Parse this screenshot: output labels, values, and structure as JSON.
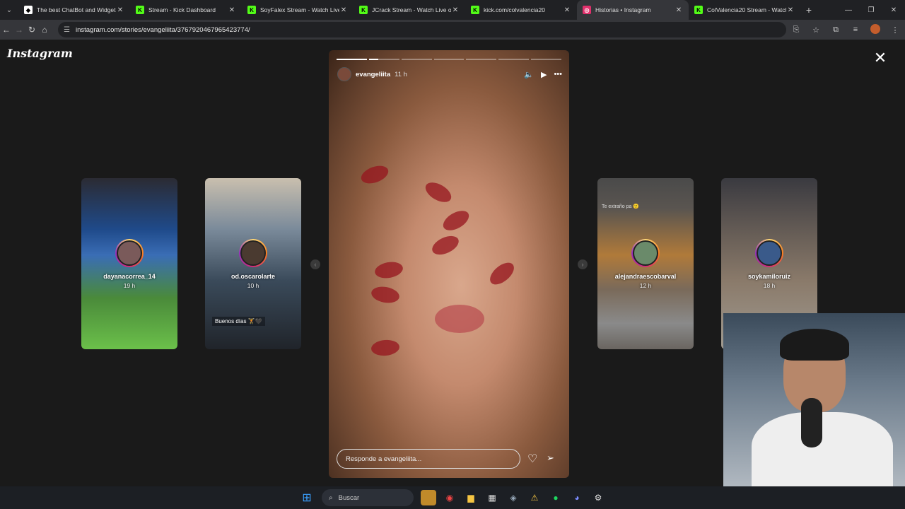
{
  "browser": {
    "tabs": [
      {
        "title": "The best ChatBot and Widgets",
        "favicon_color": "#ffffff",
        "favicon_glyph": "◆"
      },
      {
        "title": "Stream - Kick Dashboard",
        "favicon_color": "#53fc18",
        "favicon_glyph": "K"
      },
      {
        "title": "SoyFalex Stream - Watch Live o",
        "favicon_color": "#53fc18",
        "favicon_glyph": "K"
      },
      {
        "title": "JCrack Stream - Watch Live on",
        "favicon_color": "#53fc18",
        "favicon_glyph": "K"
      },
      {
        "title": "kick.com/colvalencia20",
        "favicon_color": "#53fc18",
        "favicon_glyph": "K"
      },
      {
        "title": "Historias • Instagram",
        "favicon_color": "#e1306c",
        "favicon_glyph": "◎"
      },
      {
        "title": "ColValencia20 Stream - Watch",
        "favicon_color": "#53fc18",
        "favicon_glyph": "K"
      }
    ],
    "url": "instagram.com/stories/evangeliita/3767920467965423774/"
  },
  "instagram": {
    "logo": "Instagram",
    "main_story": {
      "username": "evangeliita",
      "time": "11 h",
      "reply_placeholder": "Responde a evangeliita..."
    },
    "side_stories": [
      {
        "username": "dayanacorrea_14",
        "time": "19 h"
      },
      {
        "username": "od.oscarolarte",
        "time": "10 h",
        "caption": "Buenos días 🏋️🖤"
      },
      {
        "username": "alejandraescobarval",
        "time": "12 h",
        "top_note": "Te extraño pa 🙂"
      },
      {
        "username": "soykamiloruiz",
        "time": "18 h"
      }
    ]
  },
  "taskbar": {
    "search_label": "Buscar"
  }
}
